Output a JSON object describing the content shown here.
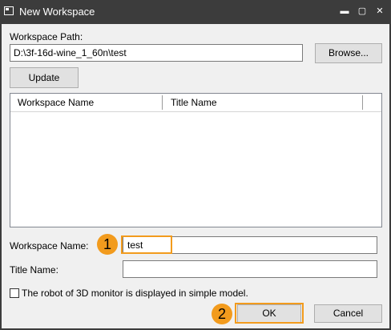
{
  "window": {
    "title": "New Workspace",
    "controls": {
      "minimize": "▬",
      "maximize": "▢",
      "close": "✕"
    }
  },
  "path": {
    "label": "Workspace Path:",
    "value": "D:\\3f-16d-wine_1_60n\\test",
    "browse_label": "Browse..."
  },
  "update_label": "Update",
  "list": {
    "columns": [
      "Workspace Name",
      "Title Name"
    ]
  },
  "workspace_name": {
    "label": "Workspace Name:",
    "value": "test"
  },
  "title_name": {
    "label": "Title Name:",
    "value": ""
  },
  "simple_model": {
    "label": "The robot of 3D monitor is displayed in simple model.",
    "checked": false
  },
  "ok_label": "OK",
  "cancel_label": "Cancel",
  "steps": {
    "one": "1",
    "two": "2"
  },
  "colors": {
    "accent": "#f29b1d",
    "titlebar": "#3c3c3c",
    "client_bg": "#f0f0f0"
  }
}
